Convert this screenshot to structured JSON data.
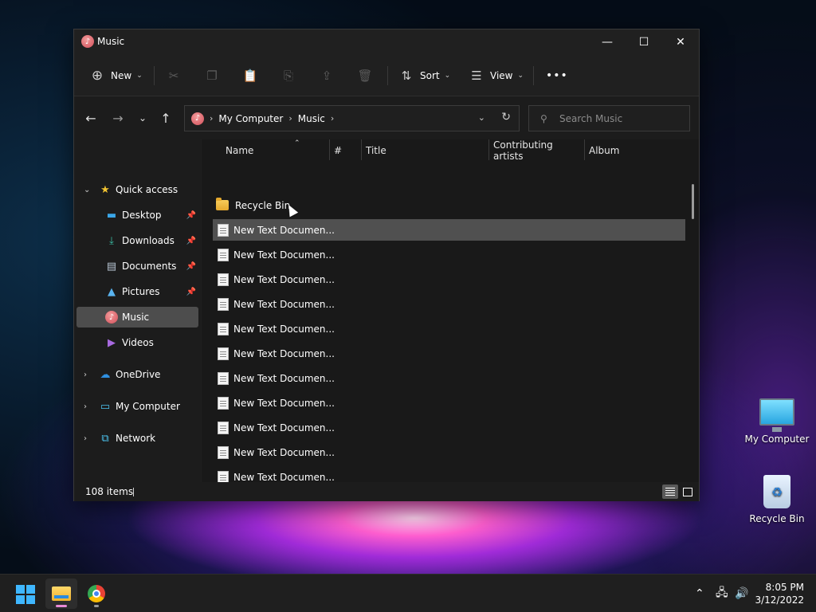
{
  "window": {
    "title": "Music",
    "controls": {
      "minimize": "—",
      "maximize": "☐",
      "close": "✕"
    }
  },
  "toolbar": {
    "new_label": "New",
    "sort_label": "Sort",
    "view_label": "View",
    "more_label": "•••"
  },
  "address": {
    "crumbs": [
      "My Computer",
      "Music"
    ],
    "search_placeholder": "Search Music"
  },
  "sidebar": {
    "quick_access": "Quick access",
    "items": [
      {
        "label": "Desktop",
        "icon": "desktop-icon",
        "pinned": true
      },
      {
        "label": "Downloads",
        "icon": "download-icon",
        "pinned": true
      },
      {
        "label": "Documents",
        "icon": "documents-icon",
        "pinned": true
      },
      {
        "label": "Pictures",
        "icon": "pictures-icon",
        "pinned": true
      },
      {
        "label": "Music",
        "icon": "music-icon",
        "selected": true
      },
      {
        "label": "Videos",
        "icon": "videos-icon"
      }
    ],
    "onedrive": "OneDrive",
    "my_computer": "My Computer",
    "network": "Network"
  },
  "columns": {
    "name": "Name",
    "number": "#",
    "title": "Title",
    "artists": "Contributing artists",
    "album": "Album"
  },
  "files": [
    {
      "name": "Recycle Bin",
      "type": "folder"
    },
    {
      "name": "New Text Documen...",
      "type": "text",
      "selected": true
    },
    {
      "name": "New Text Documen...",
      "type": "text"
    },
    {
      "name": "New Text Documen...",
      "type": "text"
    },
    {
      "name": "New Text Documen...",
      "type": "text"
    },
    {
      "name": "New Text Documen...",
      "type": "text"
    },
    {
      "name": "New Text Documen...",
      "type": "text"
    },
    {
      "name": "New Text Documen...",
      "type": "text"
    },
    {
      "name": "New Text Documen...",
      "type": "text"
    },
    {
      "name": "New Text Documen...",
      "type": "text"
    },
    {
      "name": "New Text Documen...",
      "type": "text"
    },
    {
      "name": "New Text Documen...",
      "type": "text"
    }
  ],
  "status": {
    "item_count": "108 items"
  },
  "desktop": {
    "my_computer": "My Computer",
    "recycle_bin": "Recycle Bin"
  },
  "taskbar": {
    "time": "8:05 PM",
    "date": "3/12/2022"
  },
  "colors": {
    "accent": "#3fb7ff",
    "selected_row": "#505050",
    "window_bg": "#202020"
  }
}
